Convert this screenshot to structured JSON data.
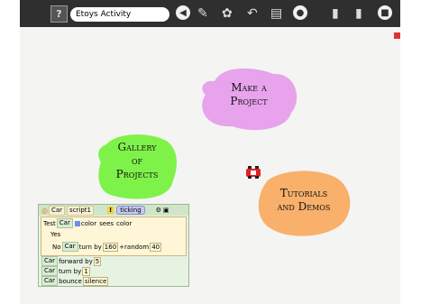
{
  "toolbar": {
    "help_label": "?",
    "title_value": "Etoys Activity",
    "icons": [
      "back-icon",
      "paint-icon",
      "supplies-icon",
      "undo-icon",
      "book-icon",
      "circle-icon",
      "share-in-icon",
      "share-out-icon",
      "stop-icon"
    ]
  },
  "blobs": {
    "make_project": [
      "Make a",
      "Project"
    ],
    "gallery": [
      "Gallery",
      "of",
      "Projects"
    ],
    "tutorials": [
      "Tutorials",
      "and Demos"
    ]
  },
  "script": {
    "object": "Car",
    "name": "script1",
    "alert": "!",
    "status": "ticking",
    "test_label": "Test",
    "test_obj": "Car",
    "test_attr": "color",
    "test_verb": "sees",
    "test_target": "color",
    "yes_label": "Yes",
    "no_label": "No",
    "no_obj": "Car",
    "no_cmd": "turn by",
    "no_num": "160",
    "no_plus": "+",
    "no_random": "random",
    "no_random_arg": "40",
    "cmd1_obj": "Car",
    "cmd1": "forward by",
    "cmd1_arg": "5",
    "cmd2_obj": "Car",
    "cmd2": "turn by",
    "cmd2_arg": "1",
    "cmd3_obj": "Car",
    "cmd3": "bounce",
    "cmd3_arg": "silence"
  },
  "colors": {
    "bar": "#2f2f2f",
    "pink": "#e7a3ec",
    "green": "#7ff24a",
    "orange": "#f8b06a"
  }
}
